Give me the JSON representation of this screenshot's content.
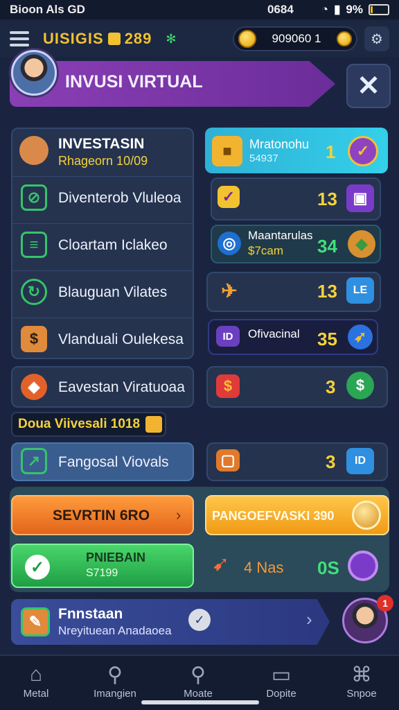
{
  "status": {
    "left": "Bioon Als GD",
    "center": "0684",
    "battery_text": "9%",
    "battery_level": 0.09
  },
  "header": {
    "brand": "UISIGIS",
    "brand_num": "289",
    "coins": "909060 1"
  },
  "banner": {
    "title": "INVUSI VIRTUAL"
  },
  "left_panel": {
    "title": "INVESTASIN",
    "subtitle": "Rhageorn 10/09",
    "items": [
      {
        "label": "Diventerob Vluleoa"
      },
      {
        "label": "Cloartam Iclakeo"
      },
      {
        "label": "Blauguan Vilates"
      },
      {
        "label": "Vlanduali Oulekesa"
      }
    ]
  },
  "left_single": {
    "label": "Eavestan Viratuoaa"
  },
  "promo": {
    "label": "Doua Viivesali 1018"
  },
  "left_bottom": {
    "label": "Fangosal Viovals"
  },
  "right_panel": {
    "rows": [
      {
        "title": "Mratonohu",
        "sub": "54937",
        "value": "1"
      },
      {
        "value": "13"
      },
      {
        "title": "Maantarulas",
        "sub": "$7cam",
        "value": "34"
      },
      {
        "value": "13"
      },
      {
        "title": "Ofivacinal",
        "value": "35"
      },
      {
        "value": "3"
      },
      {
        "value": "3"
      }
    ]
  },
  "buttons": {
    "orange": "SEVRTIN 6RO",
    "gold": "PANGOEFVASKI 390",
    "green_title": "PNIEBAIN",
    "green_sub": "S7199",
    "count_label": "4 Nas",
    "count_value": "0S"
  },
  "footer_card": {
    "title": "Fnnstaan",
    "subtitle": "Nreyituean Anadaoea",
    "badge": "1"
  },
  "nav": [
    {
      "label": "Metal"
    },
    {
      "label": "Imangien"
    },
    {
      "label": "Moate"
    },
    {
      "label": "Dopite"
    },
    {
      "label": "Snpoe"
    }
  ]
}
